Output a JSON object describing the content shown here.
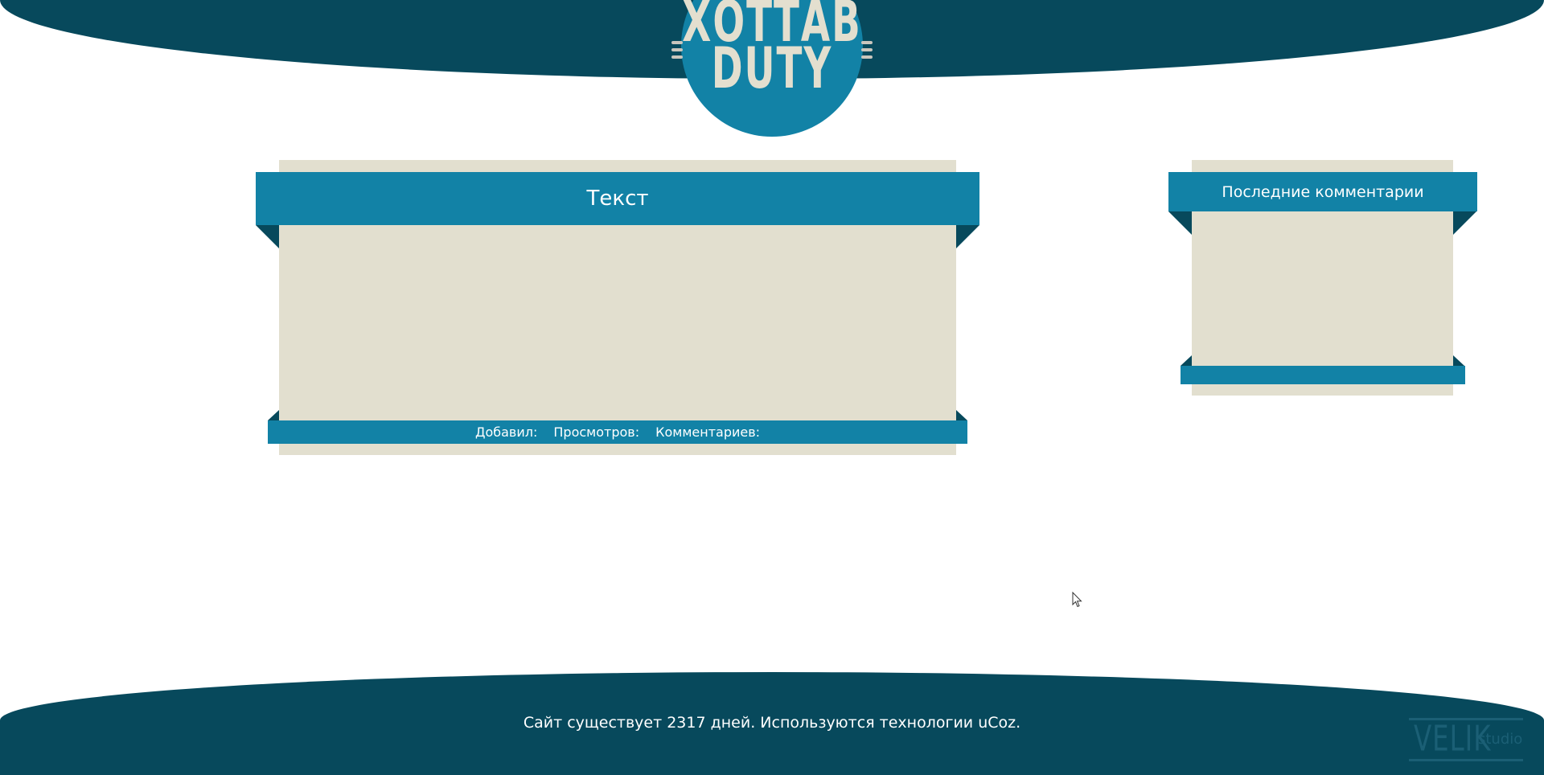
{
  "header": {
    "logo_line1": "ХОТТАВ",
    "logo_line2": "DUTY"
  },
  "main": {
    "title": "Текст",
    "meta": {
      "added_by_label": "Добавил:",
      "views_label": "Просмотров:",
      "comments_label": "Комментариев:"
    }
  },
  "sidebar": {
    "widget_title": "Последние комментарии"
  },
  "footer": {
    "text": "Сайт существует 2317 дней. Используются технологии uCoz.",
    "studio_logo_text": "VELIK",
    "studio_logo_suffix": "studio"
  },
  "colors": {
    "dark_teal": "#07495c",
    "accent_blue": "#1282a6",
    "panel_beige": "#e2dfcf"
  },
  "icons": {
    "cursor": "mouse-pointer-icon"
  }
}
